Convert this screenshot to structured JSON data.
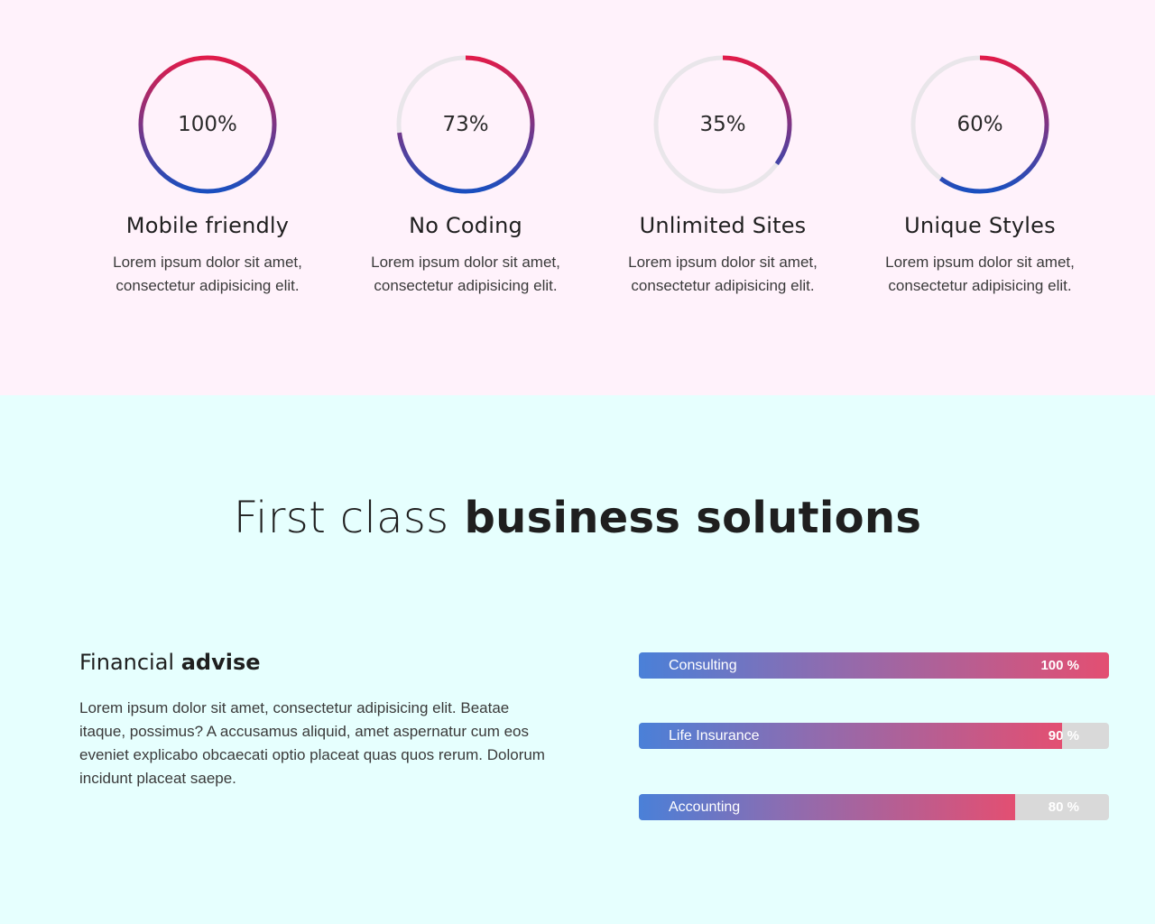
{
  "colors": {
    "top_bg": "#fff2fb",
    "bottom_bg": "#e6fffe",
    "gradient_start": "#1a4fbf",
    "gradient_end": "#e01b4a",
    "track": "#e9e6ea",
    "bar_track": "#d9d9d9"
  },
  "features": [
    {
      "percent_label": "100%",
      "percent": 100,
      "title": "Mobile friendly",
      "desc_line1": "Lorem ipsum dolor sit amet,",
      "desc_line2": "consectetur adipisicing elit."
    },
    {
      "percent_label": "73%",
      "percent": 73,
      "title": "No Coding",
      "desc_line1": "Lorem ipsum dolor sit amet,",
      "desc_line2": "consectetur adipisicing elit."
    },
    {
      "percent_label": "35%",
      "percent": 35,
      "title": "Unlimited Sites",
      "desc_line1": "Lorem ipsum dolor sit amet,",
      "desc_line2": "consectetur adipisicing elit."
    },
    {
      "percent_label": "60%",
      "percent": 60,
      "title": "Unique Styles",
      "desc_line1": "Lorem ipsum dolor sit amet,",
      "desc_line2": "consectetur adipisicing elit."
    }
  ],
  "headline": {
    "light": "First class",
    "bold": "business solutions"
  },
  "financial": {
    "title_light": "Financial",
    "title_bold": "advise",
    "text": "Lorem ipsum dolor sit amet, consectetur adipisicing elit. Beatae itaque, possimus? A accusamus aliquid, amet aspernatur cum eos eveniet explicabo obcaecati optio placeat quas quos rerum. Dolorum incidunt placeat saepe."
  },
  "skills": [
    {
      "label": "Consulting",
      "value_label": "100 %",
      "percent": 100
    },
    {
      "label": "Life Insurance",
      "value_label": "90 %",
      "percent": 90
    },
    {
      "label": "Accounting",
      "value_label": "80 %",
      "percent": 80
    }
  ]
}
